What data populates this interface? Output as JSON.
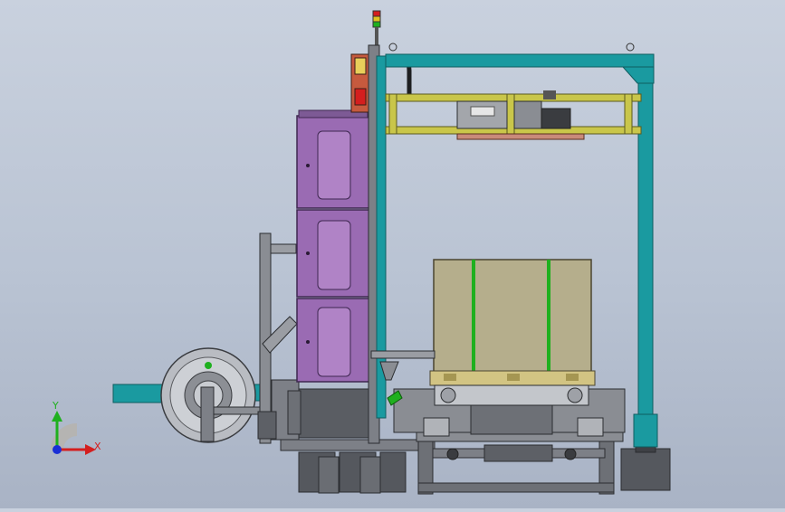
{
  "triad": {
    "x_label": "X",
    "y_label": "Y",
    "x_color": "#d41e1e",
    "y_color": "#1fb01f",
    "z_color": "#1a2fd6"
  },
  "colors": {
    "background_top": "#c9d1de",
    "background_bottom": "#a9b3c5",
    "frame_teal": "#1a9aa0",
    "cabinet_purple": "#9a6bb3",
    "cargo_tan": "#b5ae8c",
    "carriage_yellow": "#c9c64a",
    "steel_gray": "#7d8087",
    "dark_gray": "#4a4d52"
  },
  "model_parts": [
    "strapping-machine-frame",
    "control-cabinet",
    "strap-dispenser-reel",
    "cargo-pallet",
    "conveyor-bed",
    "strapping-head-carriage",
    "signal-tower"
  ]
}
